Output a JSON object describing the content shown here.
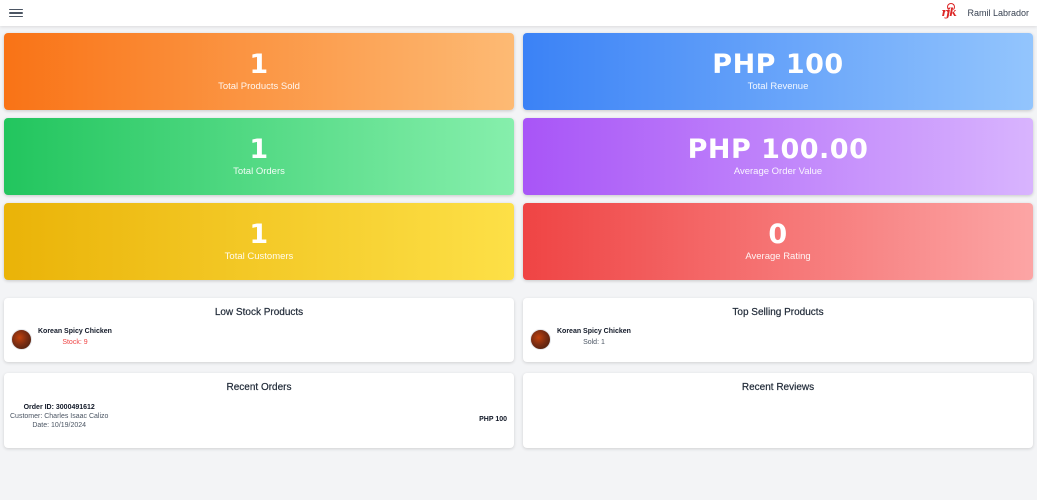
{
  "header": {
    "user_name": "Ramil Labrador"
  },
  "stats": {
    "products_sold": {
      "value": "1",
      "label": "Total Products Sold"
    },
    "revenue": {
      "value": "PHP 100",
      "label": "Total Revenue"
    },
    "orders": {
      "value": "1",
      "label": "Total Orders"
    },
    "avg_order_value": {
      "value": "PHP 100.00",
      "label": "Average Order Value"
    },
    "customers": {
      "value": "1",
      "label": "Total Customers"
    },
    "avg_rating": {
      "value": "0",
      "label": "Average Rating"
    }
  },
  "low_stock": {
    "title": "Low Stock Products",
    "items": [
      {
        "name": "Korean Spicy Chicken",
        "stock": "Stock: 9"
      }
    ]
  },
  "top_selling": {
    "title": "Top Selling Products",
    "items": [
      {
        "name": "Korean Spicy Chicken",
        "sold": "Sold: 1"
      }
    ]
  },
  "recent_orders": {
    "title": "Recent Orders",
    "items": [
      {
        "order_id": "Order ID: 3000491612",
        "customer": "Customer: Charles Isaac Calizo",
        "date": "Date: 10/19/2024",
        "total": "PHP 100"
      }
    ]
  },
  "recent_reviews": {
    "title": "Recent Reviews"
  },
  "colors": {
    "orange": "#f97316",
    "blue": "#3b82f6",
    "green": "#22c55e",
    "purple": "#a855f7",
    "yellow": "#eab308",
    "red": "#ef4444"
  },
  "icons": {
    "menu": "hamburger-menu-icon",
    "logo": "brand-logo",
    "product_thumb": "product-thumbnail"
  }
}
